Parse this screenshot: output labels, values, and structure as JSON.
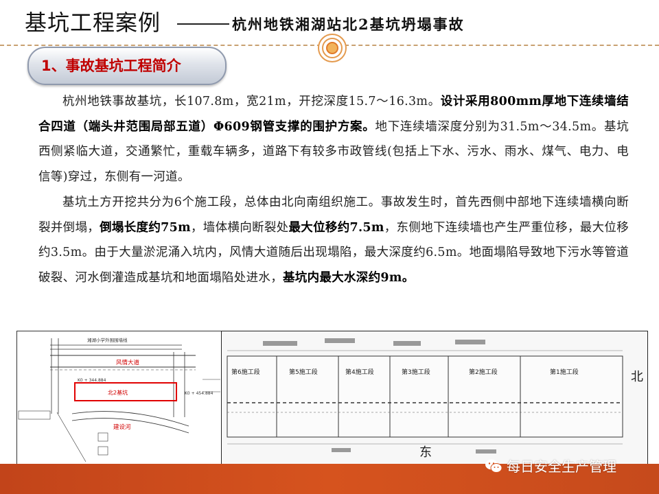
{
  "header": {
    "title": "基坑工程案例",
    "subtitle": "杭州地铁湘湖站北2基坑坍塌事故"
  },
  "section": {
    "label": "1、事故基坑工程简介"
  },
  "paragraph1": {
    "t1": "杭州地铁事故基坑，长107.8m，宽21m，开挖深度15.7～16.3m。",
    "b1": "设计采用800mm厚地下连续墙结合四道（端头井范围局部五道）Φ609钢管支撑的围护方案。",
    "t2": "地下连续墙深度分别为31.5m～34.5m。基坑西侧紧临大道，交通繁忙，重载车辆多，道路下有较多市政管线(包括上下水、污水、雨水、煤气、电力、电信等)穿过，东侧有一河道。"
  },
  "paragraph2": {
    "t1": "基坑土方开挖共分为6个施工段，总体由北向南组织施工。事故发生时，首先西侧中部地下连续墙横向断裂并倒塌，",
    "b1": "倒塌长度约75m",
    "t2": "，墙体横向断裂处",
    "b2": "最大位移约7.5m",
    "t3": "，东侧地下连续墙也产生严重位移，最大位移约3.5m。由于大量淤泥涌入坑内，风情大道随后出现塌陷，最大深度约6.5m。地面塌陷导致地下污水等管道破裂、河水倒灌造成基坑和地面塌陷处进水，",
    "b3": "基坑内最大水深约9m。"
  },
  "site_map": {
    "road": "风情大道",
    "pit": "北2基坑",
    "river": "建设河",
    "chainage_left": "K0 + 344.884",
    "chainage_right": "K0 + 454.884",
    "school": "湘湖小学外围围墙线"
  },
  "plan": {
    "sections": [
      "第6施工段",
      "第5施工段",
      "第4施工段",
      "第3施工段",
      "第2施工段",
      "第1施工段"
    ],
    "north": "北",
    "east": "东"
  },
  "watermark": {
    "text": "每日安全生产管理"
  },
  "colors": {
    "accent": "#c00000",
    "band": "#d6531e",
    "pit_outline": "#e00000"
  }
}
